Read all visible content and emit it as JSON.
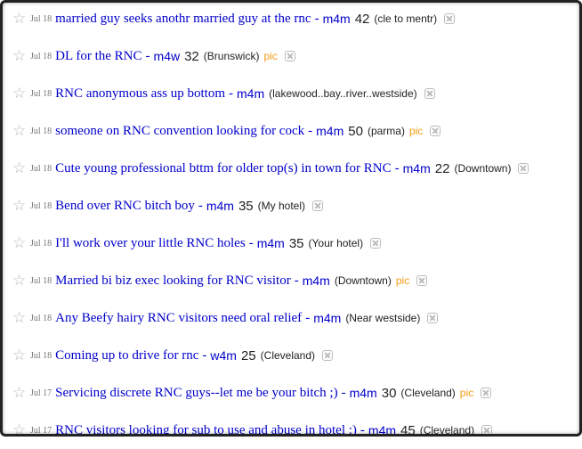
{
  "listings": [
    {
      "date": "Jul 18",
      "title": "married guy seeks anothr married guy at the rnc",
      "category": "m4m",
      "age": "42",
      "location": "(cle to mentr)",
      "pic": ""
    },
    {
      "date": "Jul 18",
      "title": "DL for the RNC",
      "category": "m4w",
      "age": "32",
      "location": "(Brunswick)",
      "pic": "pic"
    },
    {
      "date": "Jul 18",
      "title": "RNC anonymous ass up bottom",
      "category": "m4m",
      "age": "",
      "location": "(lakewood..bay..river..westside)",
      "pic": ""
    },
    {
      "date": "Jul 18",
      "title": "someone on RNC convention looking for cock",
      "category": "m4m",
      "age": "50",
      "location": "(parma)",
      "pic": "pic"
    },
    {
      "date": "Jul 18",
      "title": "Cute young professional bttm for older top(s) in town for RNC",
      "category": "m4m",
      "age": "22",
      "location": "(Downtown)",
      "pic": ""
    },
    {
      "date": "Jul 18",
      "title": "Bend over RNC bitch boy",
      "category": "m4m",
      "age": "35",
      "location": "(My hotel)",
      "pic": ""
    },
    {
      "date": "Jul 18",
      "title": "I'll work over your little RNC holes",
      "category": "m4m",
      "age": "35",
      "location": "(Your hotel)",
      "pic": ""
    },
    {
      "date": "Jul 18",
      "title": "Married bi biz exec looking for RNC visitor",
      "category": "m4m",
      "age": "",
      "location": "(Downtown)",
      "pic": "pic"
    },
    {
      "date": "Jul 18",
      "title": "Any Beefy hairy RNC visitors need oral relief",
      "category": "m4m",
      "age": "",
      "location": "(Near westside)",
      "pic": ""
    },
    {
      "date": "Jul 18",
      "title": "Coming up to drive for rnc",
      "category": "w4m",
      "age": "25",
      "location": "(Cleveland)",
      "pic": ""
    },
    {
      "date": "Jul 17",
      "title": "Servicing discrete RNC guys--let me be your bitch ;)",
      "category": "m4m",
      "age": "30",
      "location": "(Cleveland)",
      "pic": "pic"
    },
    {
      "date": "Jul 17",
      "title": "RNC visitors looking for sub to use and abuse in hotel :)",
      "category": "m4m",
      "age": "45",
      "location": "(Cleveland)",
      "pic": ""
    }
  ],
  "icons": {
    "favorite": "star-icon",
    "hide": "hide-icon"
  },
  "colors": {
    "link": "#0000cc",
    "pic": "#f39c12",
    "date": "#777777",
    "star": "#b8b8b8"
  }
}
